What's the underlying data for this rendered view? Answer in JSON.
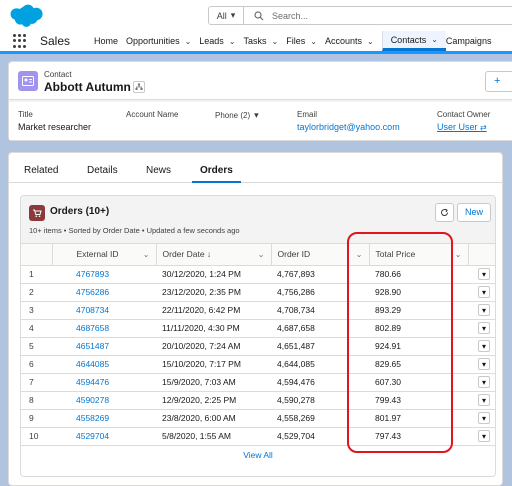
{
  "header": {
    "search_scope": "All",
    "search_placeholder": "Search..."
  },
  "nav": {
    "app_name": "Sales",
    "items": [
      {
        "label": "Home",
        "dropdown": false
      },
      {
        "label": "Opportunities",
        "dropdown": true
      },
      {
        "label": "Leads",
        "dropdown": true
      },
      {
        "label": "Tasks",
        "dropdown": true
      },
      {
        "label": "Files",
        "dropdown": true
      },
      {
        "label": "Accounts",
        "dropdown": true
      },
      {
        "label": "Contacts",
        "dropdown": true,
        "active": true
      },
      {
        "label": "Campaigns",
        "dropdown": false
      }
    ]
  },
  "record": {
    "object_label": "Contact",
    "name": "Abbott Autumn",
    "follow_label": "+",
    "fields": {
      "title_label": "Title",
      "title_value": "Market researcher",
      "account_label": "Account Name",
      "phone_label": "Phone (2)",
      "email_label": "Email",
      "email_value": "taylorbridget@yahoo.com",
      "owner_label": "Contact Owner",
      "owner_value": "User User"
    }
  },
  "tabs": [
    "Related",
    "Details",
    "News",
    "Orders"
  ],
  "active_tab": "Orders",
  "orders": {
    "title": "Orders (10+)",
    "subtitle": "10+ items • Sorted by Order Date • Updated a few seconds ago",
    "new_label": "New",
    "columns": [
      "External ID",
      "Order Date ↓",
      "Order ID",
      "Total Price"
    ],
    "rows": [
      {
        "n": "1",
        "ext": "4767893",
        "date": "30/12/2020, 1:24 PM",
        "oid": "4,767,893",
        "price": "780.66"
      },
      {
        "n": "2",
        "ext": "4756286",
        "date": "23/12/2020, 2:35 PM",
        "oid": "4,756,286",
        "price": "928.90"
      },
      {
        "n": "3",
        "ext": "4708734",
        "date": "22/11/2020, 6:42 PM",
        "oid": "4,708,734",
        "price": "893.29"
      },
      {
        "n": "4",
        "ext": "4687658",
        "date": "11/11/2020, 4:30 PM",
        "oid": "4,687,658",
        "price": "802.89"
      },
      {
        "n": "5",
        "ext": "4651487",
        "date": "20/10/2020, 7:24 AM",
        "oid": "4,651,487",
        "price": "924.91"
      },
      {
        "n": "6",
        "ext": "4644085",
        "date": "15/10/2020, 7:17 PM",
        "oid": "4,644,085",
        "price": "829.65"
      },
      {
        "n": "7",
        "ext": "4594476",
        "date": "15/9/2020, 7:03 AM",
        "oid": "4,594,476",
        "price": "607.30"
      },
      {
        "n": "8",
        "ext": "4590278",
        "date": "12/9/2020, 2:25 PM",
        "oid": "4,590,278",
        "price": "799.43"
      },
      {
        "n": "9",
        "ext": "4558269",
        "date": "23/8/2020, 6:00 AM",
        "oid": "4,558,269",
        "price": "801.97"
      },
      {
        "n": "10",
        "ext": "4529704",
        "date": "5/8/2020, 1:55 AM",
        "oid": "4,529,704",
        "price": "797.43"
      }
    ],
    "view_all": "View All"
  },
  "colors": {
    "brand": "#0176d3",
    "highlight": "#e0151d",
    "contact_icon": "#a094ed",
    "orders_icon": "#8a3a3a"
  }
}
